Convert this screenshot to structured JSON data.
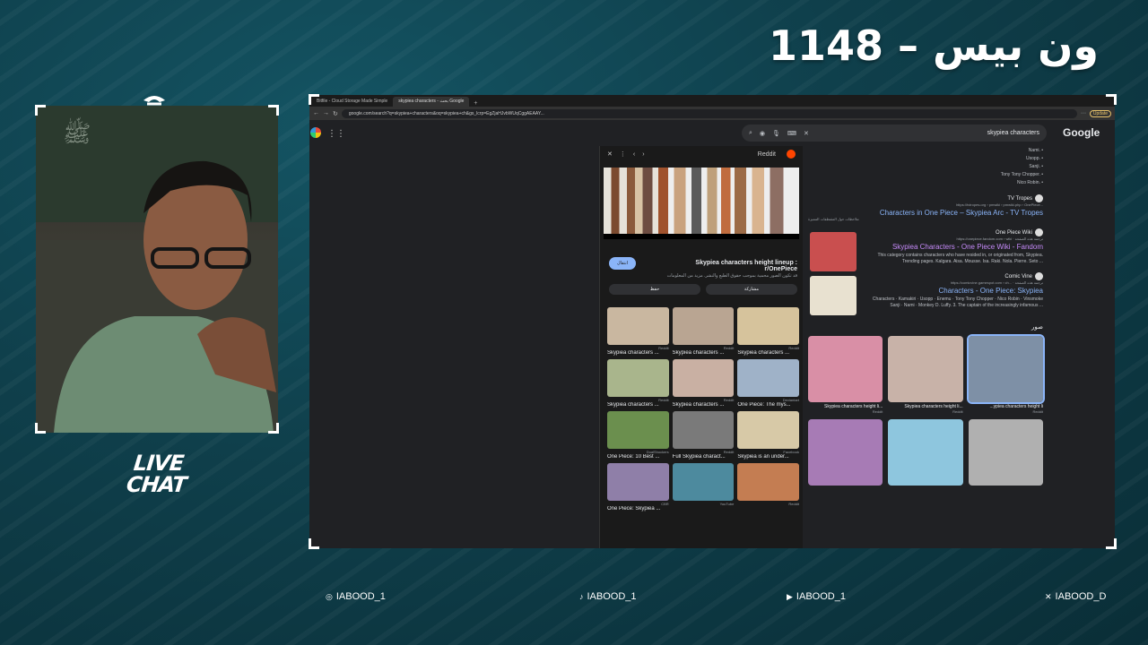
{
  "stream": {
    "title": "ون بيس – 1148",
    "live_chat_label": "LIVE CHAT"
  },
  "browser": {
    "tabs": [
      {
        "label": "Bitfile - Cloud Storage Made Simple",
        "active": false
      },
      {
        "label": "skypiea characters - بحث Google",
        "active": true
      }
    ],
    "address": "google.com/search?q=skypiea+characters&oq=skypiea+ch&gs_lcrp=EgZjaHJvbWUqCggAEAAY...",
    "update_label": "Update"
  },
  "search": {
    "query": "skypiea characters",
    "logo": "Google"
  },
  "viewer": {
    "site": "Reddit",
    "title": "Skypiea characters height lineup : r/OnePiece",
    "subtitle": "قد تكون الصور محمية بموجب حقوق الطبع والنشر. مزيد من المعلومات",
    "visit_label": "انتقال",
    "share_label": "مشاركة",
    "save_label": "حفظ",
    "related": [
      {
        "caption": "Skypiea characters ...",
        "source": "Reddit",
        "color": "#c9b7a0"
      },
      {
        "caption": "Skypiea characters ...",
        "source": "Reddit",
        "color": "#b9a592"
      },
      {
        "caption": "Skypiea characters ...",
        "source": "Reddit",
        "color": "#d6c39c"
      },
      {
        "caption": "Skypiea characters ...",
        "source": "Reddit",
        "color": "#a9b58c"
      },
      {
        "caption": "Skypiea characters ...",
        "source": "Reddit",
        "color": "#c9b0a3"
      },
      {
        "caption": "One Piece: The mys...",
        "source": "Deviantart",
        "color": "#9fb2c8"
      },
      {
        "caption": "One Piece: 10 Best ...",
        "source": "DualShockers",
        "color": "#6b8f4e"
      },
      {
        "caption": "Full Skypiea charact...",
        "source": "Reddit",
        "color": "#7a7a7a"
      },
      {
        "caption": "Skypiea is an under...",
        "source": "Facebook",
        "color": "#d7c9a7"
      },
      {
        "caption": "One Piece: Skypiea ...",
        "source": "CBR",
        "color": "#8f7fa8"
      },
      {
        "caption": "",
        "source": "YouTube",
        "color": "#4d8a9e"
      },
      {
        "caption": "",
        "source": "Reddit",
        "color": "#c47d52"
      }
    ]
  },
  "results": {
    "bullets": [
      "Nami.",
      "Usopp.",
      "Sanji.",
      "Tony Tony Chopper.",
      "Nico Robin."
    ],
    "items": [
      {
        "site": "TV Tropes",
        "url": "https://tvtropes.org › pmwiki › pmwiki.php › OnePiece...",
        "title": "Characters in One Piece – Skypiea Arc - TV Tropes",
        "snippet": "",
        "visited": false,
        "thumb_color": ""
      },
      {
        "site": "One Piece Wiki",
        "url": "https://onepiece.fandom.com › wiki · ترجمة هذه الصفحة",
        "title": "Skypiea Characters - One Piece Wiki - Fandom",
        "snippet": "This category contains characters who have resided in, or originated from, Skypiea. Trending pages. Kalgara. Aisa. Mousse. Isa. Raki. Nola. Pierre. Seto ...",
        "visited": true,
        "thumb_color": "#c94f4f"
      },
      {
        "site": "Comic Vine",
        "url": "https://comicvine.gamespot.com › ch... · ترجمة هذه الصفحة",
        "title": "Characters - One Piece: Skypiea",
        "snippet": "Characters · Kamakiri · Usopp · Enemu · Tony Tony Chopper · Nico Robin · Vinsmoke Sanji · Nami · Monkey D. Luffy. 3. The captain of the increasingly infamous ...",
        "visited": false,
        "thumb_color": "#e8e1d0"
      }
    ],
    "feedback": "ملاحظات حول المقتطفات المميزة",
    "images_heading": "صور",
    "images": [
      {
        "caption": "Skypiea characters height li...",
        "source": "Reddit",
        "color": "#d98fa6",
        "selected": false
      },
      {
        "caption": "Skypiea characters height li...",
        "source": "Reddit",
        "color": "#c8b2a8",
        "selected": false
      },
      {
        "caption": "...ypiea characters height li",
        "source": "Reddit",
        "color": "#7e90a6",
        "selected": true
      },
      {
        "caption": "",
        "source": "",
        "color": "#a77bb5",
        "selected": false
      },
      {
        "caption": "",
        "source": "",
        "color": "#8ec6de",
        "selected": false
      },
      {
        "caption": "",
        "source": "",
        "color": "#b0b0b0",
        "selected": false
      }
    ]
  },
  "socials": [
    {
      "icon": "instagram-icon",
      "glyph": "◎",
      "handle": "IABOOD_1"
    },
    {
      "icon": "tiktok-icon",
      "glyph": "♪",
      "handle": "IABOOD_1"
    },
    {
      "icon": "youtube-icon",
      "glyph": "▶",
      "handle": "IABOOD_1"
    },
    {
      "icon": "x-icon",
      "glyph": "✕",
      "handle": "IABOOD_D"
    }
  ]
}
